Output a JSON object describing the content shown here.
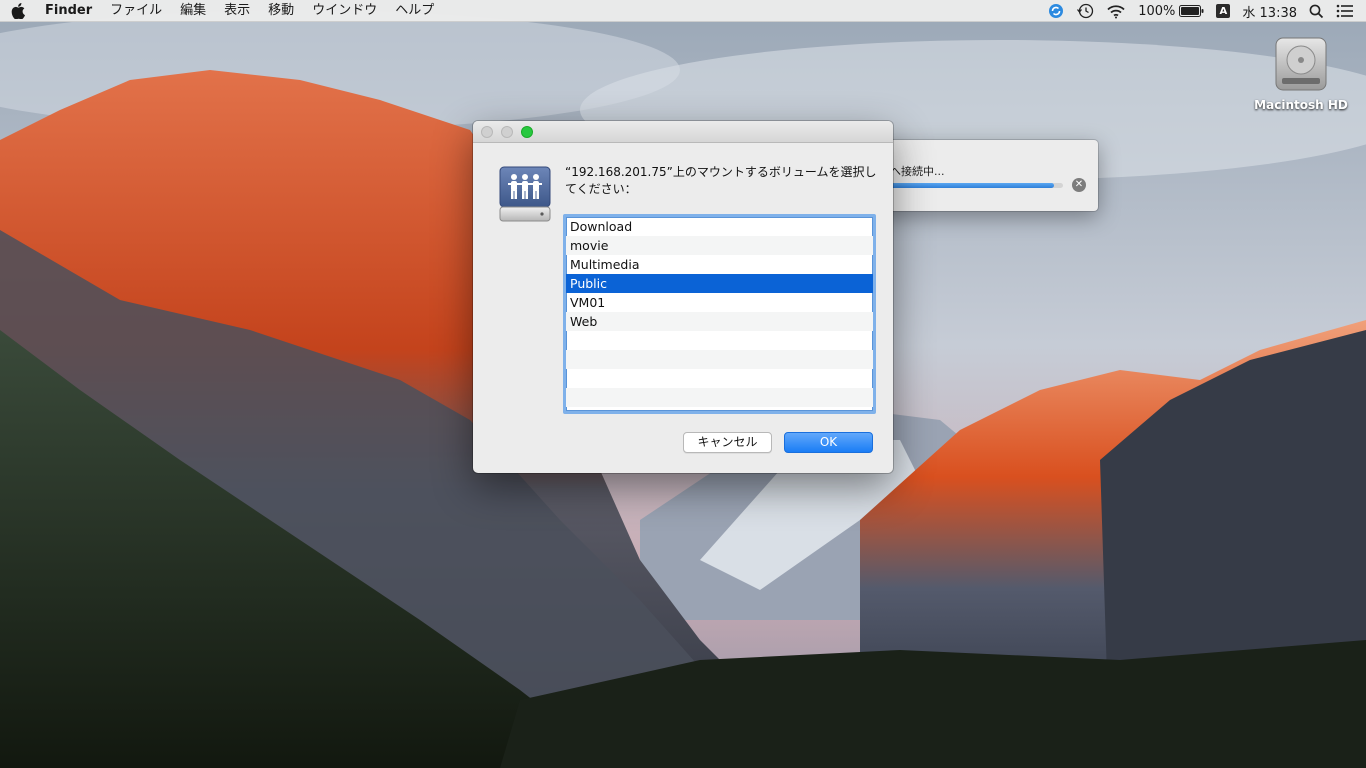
{
  "menubar": {
    "app_name": "Finder",
    "items": [
      "ファイル",
      "編集",
      "表示",
      "移動",
      "ウインドウ",
      "ヘルプ"
    ],
    "battery_percent": "100%",
    "input_source": "A",
    "clock": "水 13:38"
  },
  "desktop": {
    "disk_label": "Macintosh HD"
  },
  "connect_window": {
    "status": "へ接続中...",
    "progress_fraction": 0.95
  },
  "dialog": {
    "prompt": "“192.168.201.75”上のマウントするボリュームを選択してください：",
    "volumes": [
      "Download",
      "movie",
      "Multimedia",
      "Public",
      "VM01",
      "Web"
    ],
    "selected_volume": "Public",
    "cancel_label": "キャンセル",
    "ok_label": "OK"
  },
  "colors": {
    "accent": "#0b63d6",
    "zoom_button": "#28c840",
    "ok_button": "#1a7df5"
  },
  "icons": {
    "apple": "apple-icon",
    "server": "shared-server-icon",
    "disk": "hard-disk-icon"
  }
}
